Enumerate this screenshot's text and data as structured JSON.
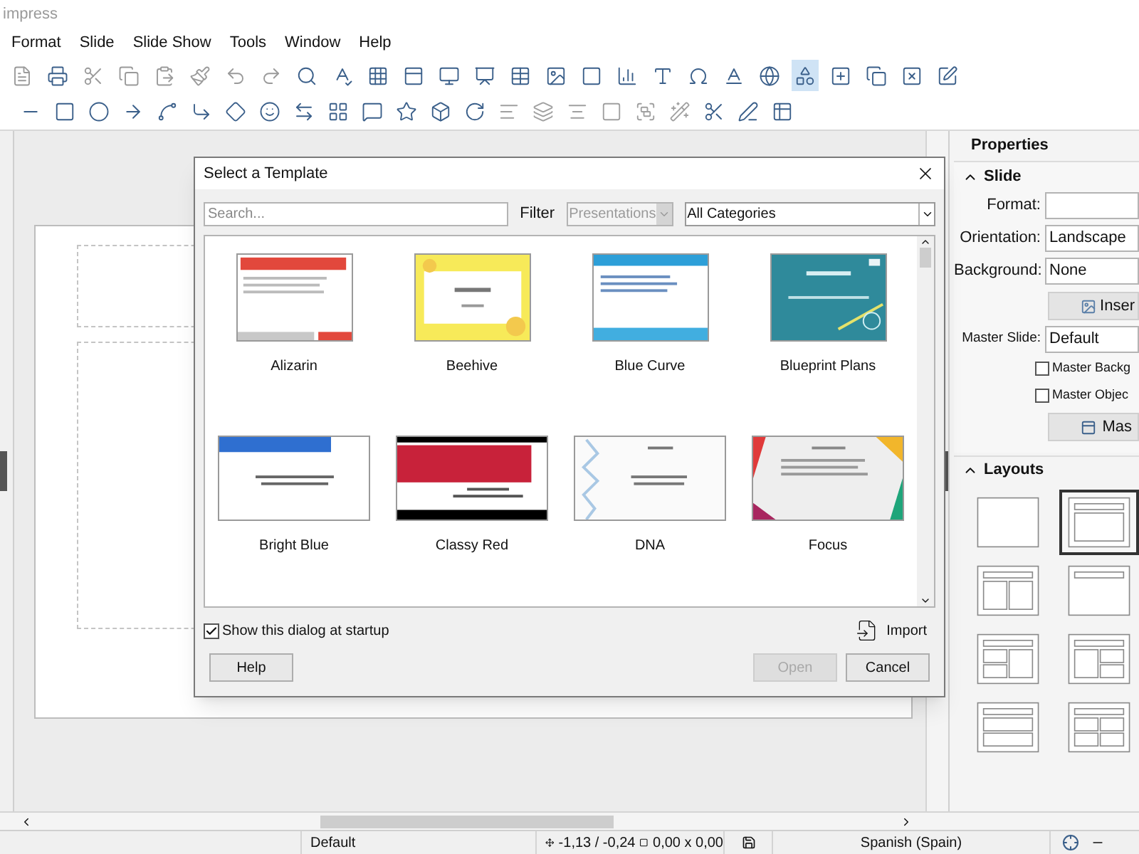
{
  "app_title": "impress",
  "menu": [
    "Format",
    "Slide",
    "Slide Show",
    "Tools",
    "Window",
    "Help"
  ],
  "dialog": {
    "title": "Select a Template",
    "search": {
      "placeholder": "Search..."
    },
    "filter_label": "Filter",
    "filter": {
      "value": "Presentations",
      "disabled": true
    },
    "category": {
      "value": "All Categories"
    },
    "templates": [
      {
        "name": "Alizarin"
      },
      {
        "name": "Beehive"
      },
      {
        "name": "Blue Curve"
      },
      {
        "name": "Blueprint Plans"
      },
      {
        "name": "Bright Blue"
      },
      {
        "name": "Classy Red"
      },
      {
        "name": "DNA"
      },
      {
        "name": "Focus"
      }
    ],
    "show_at_startup": {
      "label": "Show this dialog at startup",
      "checked": true
    },
    "import": "Import",
    "buttons": [
      {
        "label": "Help",
        "disabled": false
      },
      {
        "label": "Open",
        "disabled": true
      },
      {
        "label": "Cancel",
        "disabled": false
      }
    ]
  },
  "sidebar": {
    "title": "Properties",
    "slide": {
      "title": "Slide",
      "expanded": true,
      "format_label": "Format:",
      "orientation": {
        "label": "Orientation:",
        "value": "Landscape"
      },
      "background": {
        "label": "Background:",
        "value": "None"
      },
      "insert_button": "Inser",
      "master_slide": {
        "label": "Master Slide:",
        "value": "Default"
      },
      "checks": [
        {
          "label": "Master Backg",
          "checked": false
        },
        {
          "label": "Master Objec",
          "checked": false
        }
      ],
      "master_button": "Mas"
    },
    "layouts": {
      "title": "Layouts",
      "expanded": true,
      "items": [
        {
          "selected": false
        },
        {
          "selected": true
        },
        {
          "selected": false
        },
        {
          "selected": false
        },
        {
          "selected": false
        },
        {
          "selected": false
        },
        {
          "selected": false
        },
        {
          "selected": false
        }
      ]
    }
  },
  "status_bar": {
    "master": "Default",
    "position": "-1,13 / -0,24",
    "size": "0,00 x 0,00",
    "language": "Spanish (Spain)"
  }
}
